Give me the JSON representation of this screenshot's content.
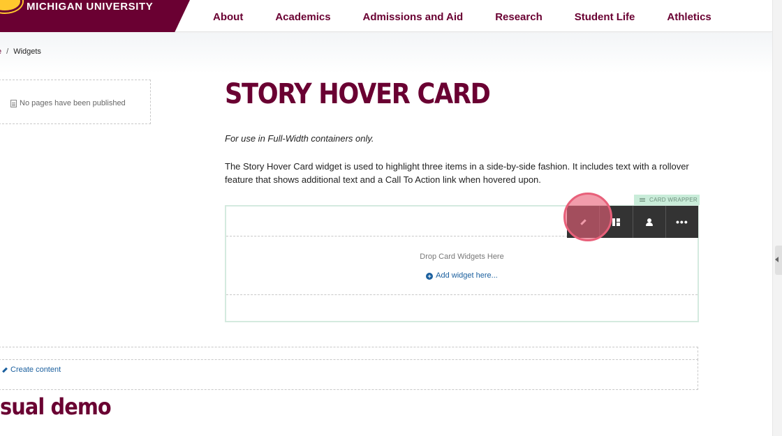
{
  "header": {
    "brand_name": "MICHIGAN UNIVERSITY",
    "nav": [
      "About",
      "Academics",
      "Admissions and Aid",
      "Research",
      "Student Life",
      "Athletics"
    ]
  },
  "breadcrumb": {
    "home_label": "e",
    "separator": "/",
    "current": "Widgets"
  },
  "sidebar": {
    "empty_message": "No pages have been published"
  },
  "main": {
    "title": "STORY HOVER CARD",
    "subtitle": "For use in Full-Width containers only.",
    "description": "The Story Hover Card widget is used to highlight three items in a side-by-side fashion. It includes text with a rollover feature that shows additional text and a Call To Action link when hovered upon."
  },
  "card_wrapper": {
    "label": "CARD WRAPPER",
    "drop_text": "Drop Card Widgets Here",
    "add_widget_label": "Add widget here...",
    "toolbar": [
      {
        "name": "edit",
        "icon": "pencil-icon"
      },
      {
        "name": "layout",
        "icon": "layout-icon"
      },
      {
        "name": "permissions",
        "icon": "user-icon"
      },
      {
        "name": "more",
        "icon": "more-icon",
        "label": "•••"
      }
    ]
  },
  "create_content": {
    "label": "Create content"
  },
  "section_heading": "sual demo",
  "colors": {
    "brand": "#6a0032",
    "accent": "#ffc82e",
    "link": "#1a5f9e",
    "wrapper_label_bg": "#c9ecd9",
    "toolbar_bg": "#333333",
    "click_marker": "#e8607a"
  }
}
